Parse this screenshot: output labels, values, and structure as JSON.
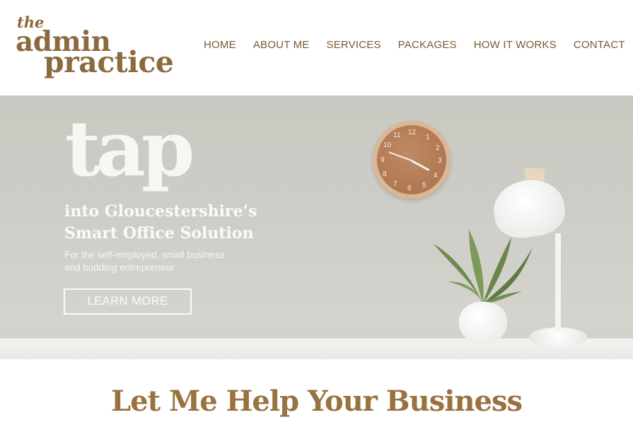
{
  "logo": {
    "line1": "the",
    "line2": "admin",
    "line3": "practice"
  },
  "nav": {
    "items": [
      {
        "label": "HOME"
      },
      {
        "label": "ABOUT ME"
      },
      {
        "label": "SERVICES"
      },
      {
        "label": "PACKAGES"
      },
      {
        "label": "HOW IT WORKS"
      },
      {
        "label": "CONTACT"
      }
    ]
  },
  "hero": {
    "headline": "tap",
    "tagline_line1": "into Gloucestershire’s",
    "tagline_line2": "Smart Office Solution",
    "subtext_line1": "For the self-employed, small business",
    "subtext_line2": "and budding entrepreneur",
    "cta_label": "LEARN MORE"
  },
  "clock": {
    "numbers": [
      "12",
      "1",
      "2",
      "3",
      "4",
      "5",
      "6",
      "7",
      "8",
      "9",
      "10",
      "11"
    ]
  },
  "section": {
    "title": "Let Me Help Your Business"
  },
  "colors": {
    "brand": "#8b6a3e",
    "nav": "#7a5a34",
    "heading": "#98723f"
  }
}
